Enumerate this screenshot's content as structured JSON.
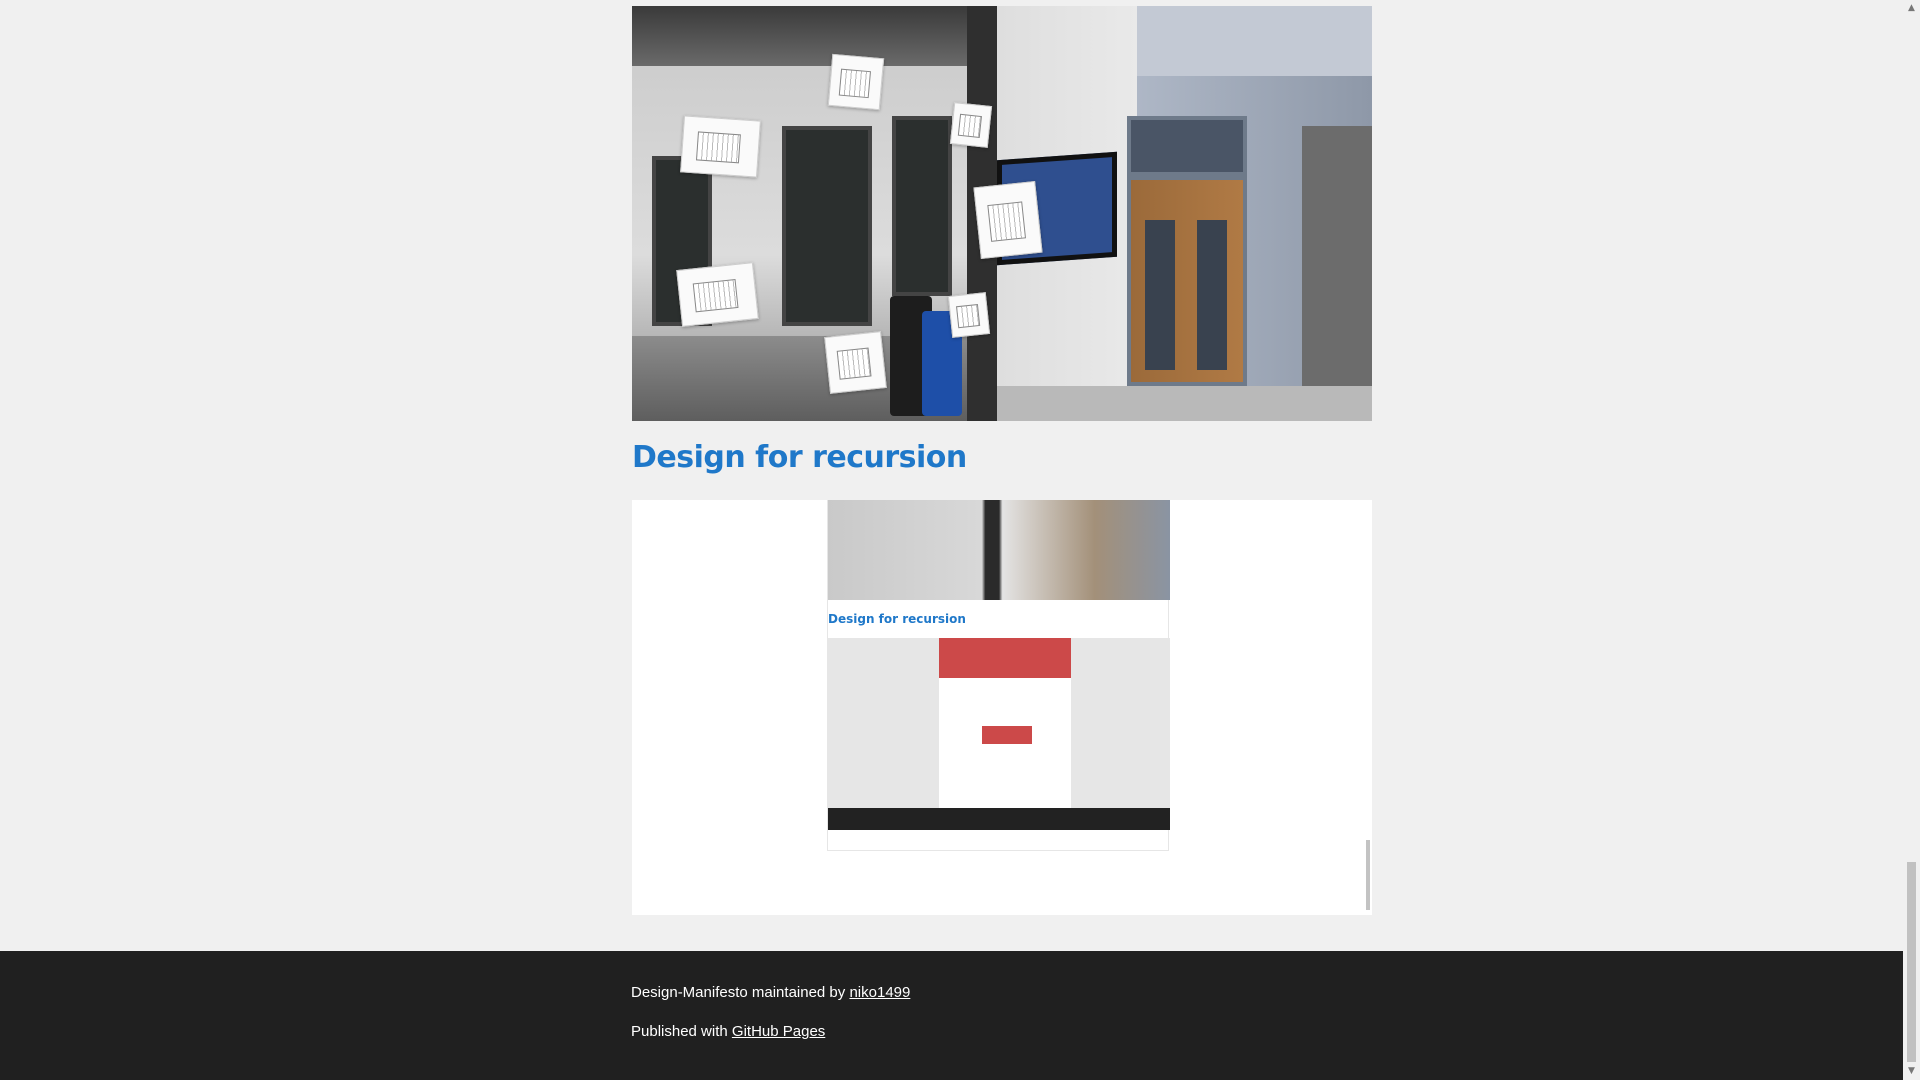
{
  "main": {
    "section_heading": "Design for recursion",
    "embedded_heading": "Design for recursion"
  },
  "footer": {
    "maintained_prefix": "Design-Manifesto maintained by",
    "maintainer_link": "niko1499",
    "published_prefix": "Published with",
    "pages_link": "GitHub Pages"
  },
  "scrollbar": {
    "up_arrow": "▲",
    "down_arrow": "▼"
  }
}
